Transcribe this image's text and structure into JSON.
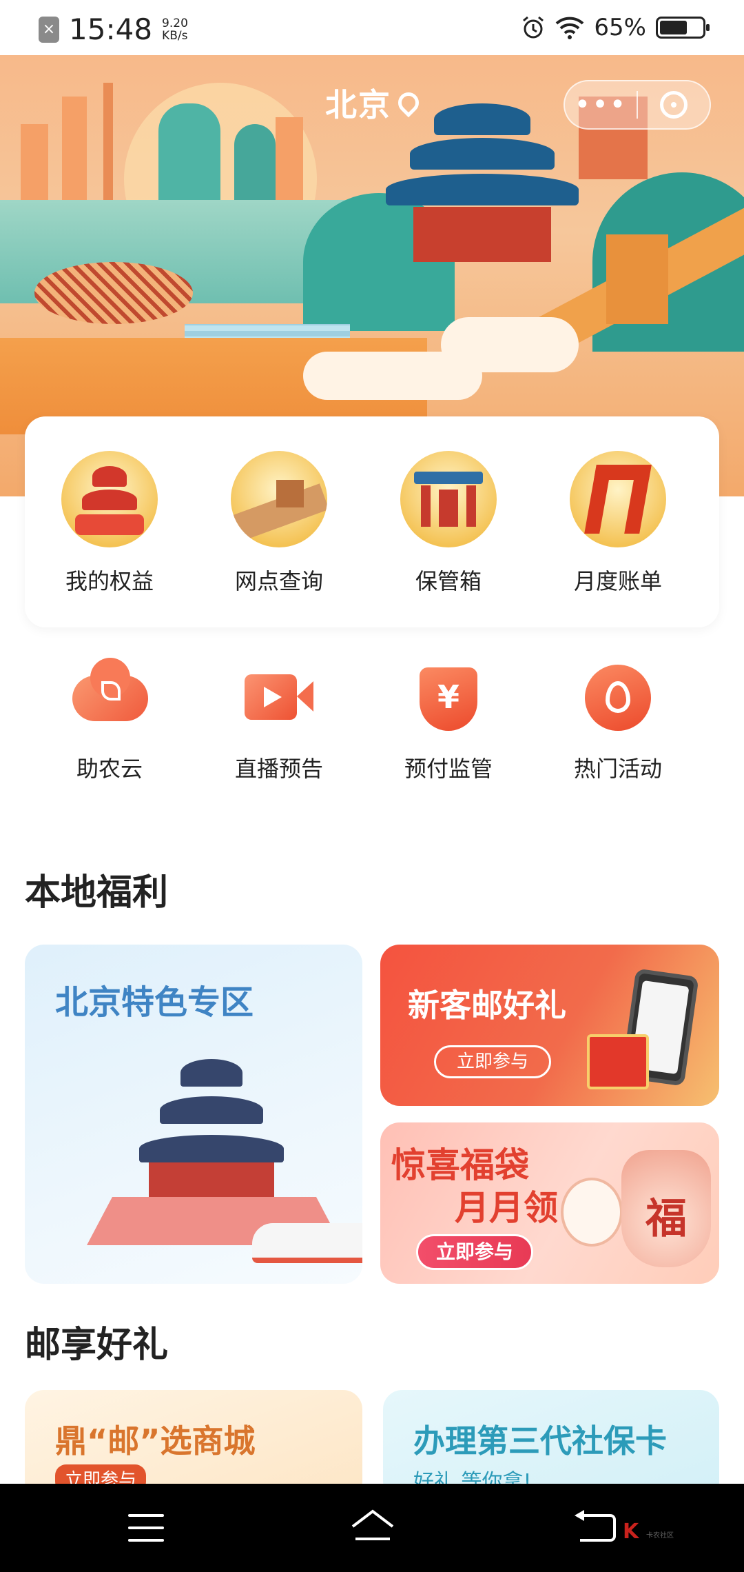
{
  "status_bar": {
    "time": "15:48",
    "net_speed_value": "9.20",
    "net_speed_unit": "KB/s",
    "battery": "65%",
    "battery_level": 0.65,
    "icons": [
      "notification-x-icon",
      "alarm-icon",
      "wifi-icon",
      "battery-icon"
    ]
  },
  "banner": {
    "city": "北京",
    "location_icon": "map-pin-icon",
    "capsule": {
      "more": "•••",
      "close_icon": "target-close-icon"
    }
  },
  "quick_access": [
    {
      "label": "我的权益",
      "icon": "temple-of-heaven-icon"
    },
    {
      "label": "网点查询",
      "icon": "great-wall-icon"
    },
    {
      "label": "保管箱",
      "icon": "archway-gate-icon"
    },
    {
      "label": "月度账单",
      "icon": "cctv-tower-icon"
    }
  ],
  "services": [
    {
      "label": "助农云",
      "icon": "cloud-sprout-icon"
    },
    {
      "label": "直播预告",
      "icon": "video-camera-icon"
    },
    {
      "label": "预付监管",
      "icon": "yen-shield-icon",
      "glyph": "¥"
    },
    {
      "label": "热门活动",
      "icon": "flame-icon"
    }
  ],
  "local_benefits": {
    "title": "本地福利",
    "beijing_zone": {
      "title": "北京特色专区"
    },
    "new_customer": {
      "title": "新客邮好礼",
      "button": "立即参与"
    },
    "lucky_bag": {
      "title_line1": "惊喜福袋",
      "title_line2": "月月领",
      "button": "立即参与",
      "bag_char": "福"
    }
  },
  "postal_gifts": {
    "title": "邮享好礼",
    "mall": {
      "title": "鼎“邮”选商城",
      "sub": "立即参与"
    },
    "social_card": {
      "title": "办理第三代社保卡",
      "sub": "好礼 等你拿!"
    }
  },
  "nav_bar": {
    "items": [
      "menu-icon",
      "home-icon",
      "back-icon"
    ],
    "watermark_mark": "K",
    "watermark_text": "卡农社区"
  }
}
